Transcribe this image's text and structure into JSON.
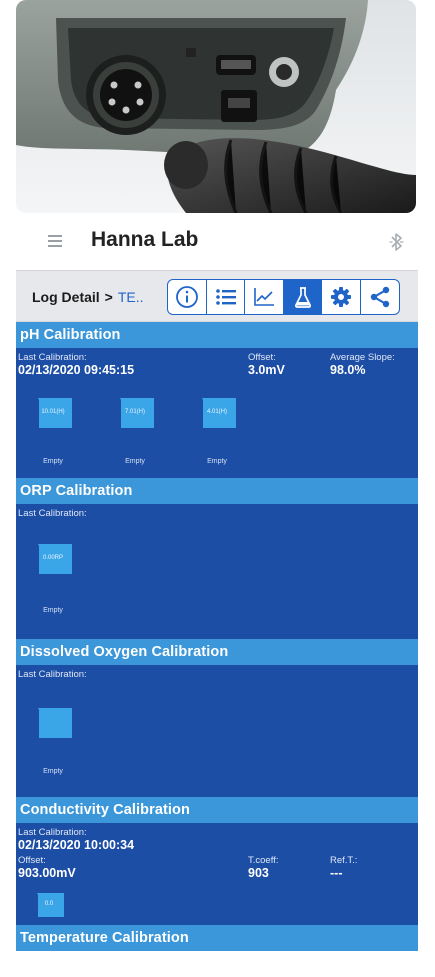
{
  "app": {
    "title": "Hanna Lab",
    "menu_icon": "hamburger-icon",
    "connection_icon": "bluetooth-icon"
  },
  "toolbar": {
    "breadcrumb_root": "Log Detail",
    "breadcrumb_separator": ">",
    "breadcrumb_current": "TE..",
    "tools": [
      {
        "name": "info-icon"
      },
      {
        "name": "list-icon"
      },
      {
        "name": "graph-icon"
      },
      {
        "name": "flask-icon",
        "active": true
      },
      {
        "name": "settings-icon"
      },
      {
        "name": "share-icon"
      }
    ]
  },
  "colors": {
    "accent": "#1f64c9",
    "section_header": "#3b97d9",
    "section_body": "#1c4ea6",
    "beaker": "#3aa6e8"
  },
  "sections": {
    "ph": {
      "title": "pH Calibration",
      "last_calibration_label": "Last Calibration:",
      "last_calibration_value": "02/13/2020 09:45:15",
      "offset_label": "Offset:",
      "offset_value": "3.0mV",
      "slope_label": "Average Slope:",
      "slope_value": "98.0%",
      "buffers": [
        {
          "label": "10.01(H)",
          "status": "Empty"
        },
        {
          "label": "7.01(H)",
          "status": "Empty"
        },
        {
          "label": "4.01(H)",
          "status": "Empty"
        }
      ]
    },
    "orp": {
      "title": "ORP Calibration",
      "last_calibration_label": "Last Calibration:",
      "buffers": [
        {
          "label": "0.00RP",
          "status": "Empty"
        }
      ]
    },
    "do": {
      "title": "Dissolved Oxygen Calibration",
      "last_calibration_label": "Last Calibration:",
      "buffers": [
        {
          "label": "",
          "status": "Empty"
        }
      ]
    },
    "ec": {
      "title": "Conductivity Calibration",
      "last_calibration_label": "Last Calibration:",
      "last_calibration_value": "02/13/2020 10:00:34",
      "offset_label": "Offset:",
      "offset_value": "903.00mV",
      "tcoeff_label": "T.coeff:",
      "tcoeff_value": "903",
      "reft_label": "Ref.T.:",
      "reft_value": "---",
      "buffers": [
        {
          "label": "0.0"
        }
      ]
    },
    "temp": {
      "title": "Temperature Calibration"
    }
  }
}
